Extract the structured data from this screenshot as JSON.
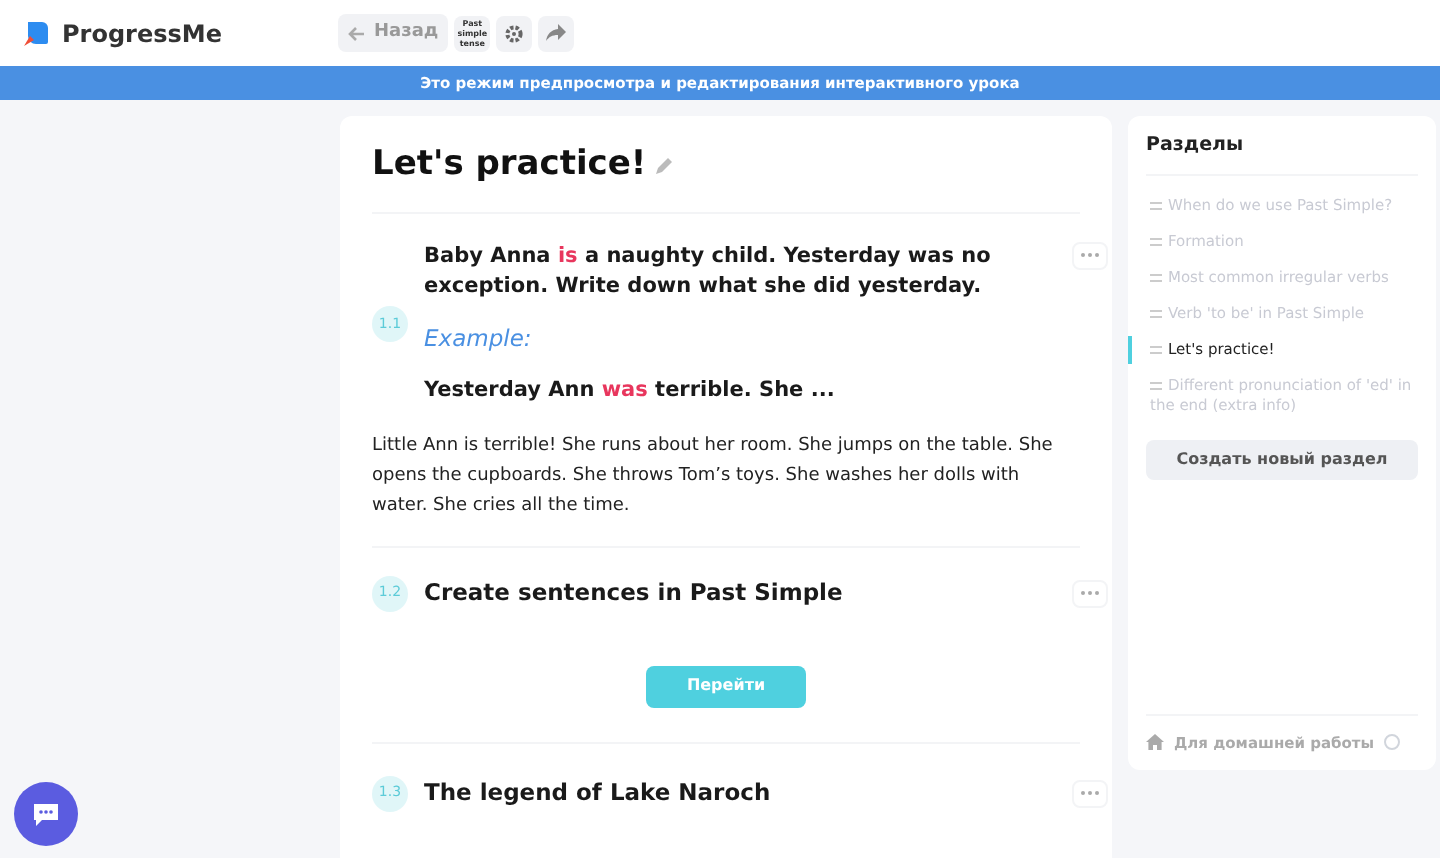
{
  "header": {
    "logo": "ProgressMe",
    "back_button": "Назад",
    "lesson_badge": "Past simple tense"
  },
  "banner": "Это режим предпросмотра и редактирования интерактивного урока",
  "lesson": {
    "title": "Let's practice!",
    "exercises": [
      {
        "kind": "task",
        "number": "1.1",
        "parts": [
          {
            "text": "Baby Anna ",
            "highlight": false
          },
          {
            "text": "is",
            "highlight": true
          },
          {
            "text": " a naughty child. Yesterday was no exception. Write down what she did yesterday.",
            "highlight": false
          }
        ],
        "example_label": "Example:",
        "example_parts": [
          {
            "text": "Yesterday Ann ",
            "highlight": false
          },
          {
            "text": "was",
            "highlight": true
          },
          {
            "text": " terrible. She ...",
            "highlight": false
          }
        ],
        "body": "Little Ann is terrible! She runs about her room. She jumps on the table. She opens the cupboards. She throws Tom’s toys. She washes her dolls with water. She cries all the time."
      },
      {
        "kind": "link",
        "number": "1.2",
        "title": "Create sentences in Past Simple",
        "button": "Перейти"
      },
      {
        "kind": "title",
        "number": "1.3",
        "title": "The legend of Lake Naroch"
      }
    ]
  },
  "sidebar": {
    "title": "Разделы",
    "sections": [
      {
        "label": "When do we use Past Simple?",
        "selected": false
      },
      {
        "label": "Formation",
        "selected": false
      },
      {
        "label": "Most common irregular verbs",
        "selected": false
      },
      {
        "label": "Verb 'to be' in Past Simple",
        "selected": false
      },
      {
        "label": "Let's practice!",
        "selected": true
      },
      {
        "label": "Different pronunciation of 'ed' in the end (extra info)",
        "selected": false
      }
    ],
    "create_button": "Создать новый раздел",
    "homework": "Для домашней работы"
  }
}
